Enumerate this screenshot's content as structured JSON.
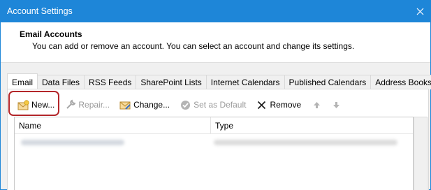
{
  "window": {
    "title": "Account Settings"
  },
  "header": {
    "title": "Email Accounts",
    "description": "You can add or remove an account. You can select an account and change its settings."
  },
  "tabs": [
    {
      "label": "Email",
      "active": true
    },
    {
      "label": "Data Files"
    },
    {
      "label": "RSS Feeds"
    },
    {
      "label": "SharePoint Lists"
    },
    {
      "label": "Internet Calendars"
    },
    {
      "label": "Published Calendars"
    },
    {
      "label": "Address Books"
    }
  ],
  "toolbar": {
    "new_label": "New...",
    "repair_label": "Repair...",
    "change_label": "Change...",
    "set_default_label": "Set as Default",
    "remove_label": "Remove"
  },
  "list": {
    "columns": {
      "name": "Name",
      "type": "Type"
    }
  },
  "colors": {
    "titlebar": "#1e86d8",
    "highlight": "#b3262a"
  },
  "icons": {
    "new": "envelope-new-icon",
    "repair": "wrench-icon",
    "change": "envelope-edit-icon",
    "set_default": "check-circle-icon",
    "remove": "x-icon",
    "move_up": "arrow-up-icon",
    "move_down": "arrow-down-icon",
    "close": "close-icon"
  }
}
